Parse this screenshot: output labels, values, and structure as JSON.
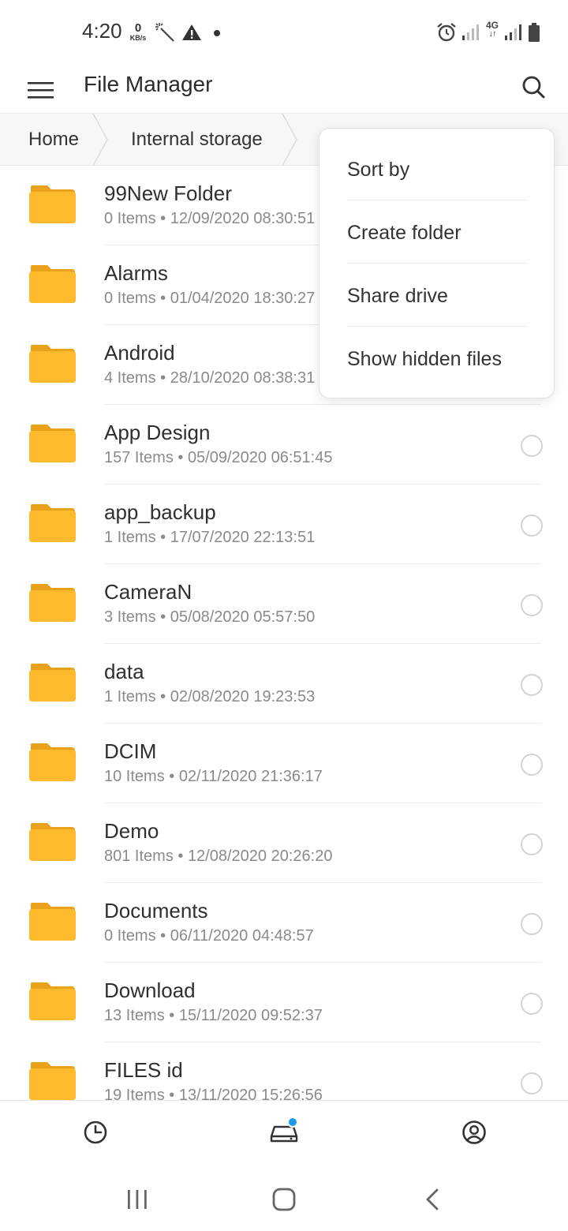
{
  "status_bar": {
    "time": "4:20",
    "speed_value": "0",
    "speed_unit": "KB/s",
    "network_label": "4G",
    "icons": [
      "magic-wand-icon",
      "alert-triangle-icon",
      "dot-icon",
      "alarm-icon",
      "signal-icon",
      "network-4g-icon",
      "signal-icon",
      "battery-icon"
    ]
  },
  "app_bar": {
    "title": "File Manager",
    "menu_icon": "hamburger-menu-icon",
    "search_icon": "search-icon"
  },
  "breadcrumb": {
    "items": [
      "Home",
      "Internal storage"
    ]
  },
  "files": [
    {
      "name": "99New Folder",
      "meta": "0 Items • 12/09/2020 08:30:51"
    },
    {
      "name": "Alarms",
      "meta": "0 Items • 01/04/2020 18:30:27"
    },
    {
      "name": "Android",
      "meta": "4 Items • 28/10/2020 08:38:31"
    },
    {
      "name": "App Design",
      "meta": "157 Items • 05/09/2020 06:51:45"
    },
    {
      "name": "app_backup",
      "meta": "1 Items • 17/07/2020 22:13:51"
    },
    {
      "name": "CameraN",
      "meta": "3 Items • 05/08/2020 05:57:50"
    },
    {
      "name": "data",
      "meta": "1 Items • 02/08/2020 19:23:53"
    },
    {
      "name": "DCIM",
      "meta": "10 Items • 02/11/2020 21:36:17"
    },
    {
      "name": "Demo",
      "meta": "801 Items • 12/08/2020 20:26:20"
    },
    {
      "name": "Documents",
      "meta": "0 Items • 06/11/2020 04:48:57"
    },
    {
      "name": "Download",
      "meta": "13 Items • 15/11/2020 09:52:37"
    },
    {
      "name": "FILES id",
      "meta": "19 Items • 13/11/2020 15:26:56"
    }
  ],
  "popup_menu": {
    "items": [
      "Sort by",
      "Create folder",
      "Share drive",
      "Show hidden files"
    ]
  },
  "bottom_nav": {
    "items": [
      "recent-clock-icon",
      "storage-drive-icon",
      "account-circle-icon"
    ]
  },
  "system_nav": {
    "items": [
      "recents-icon",
      "home-icon",
      "back-icon"
    ]
  },
  "colors": {
    "folder": "#FDBA2C",
    "folder_tab": "#E9A11A",
    "accent": "#1E9BE8"
  }
}
